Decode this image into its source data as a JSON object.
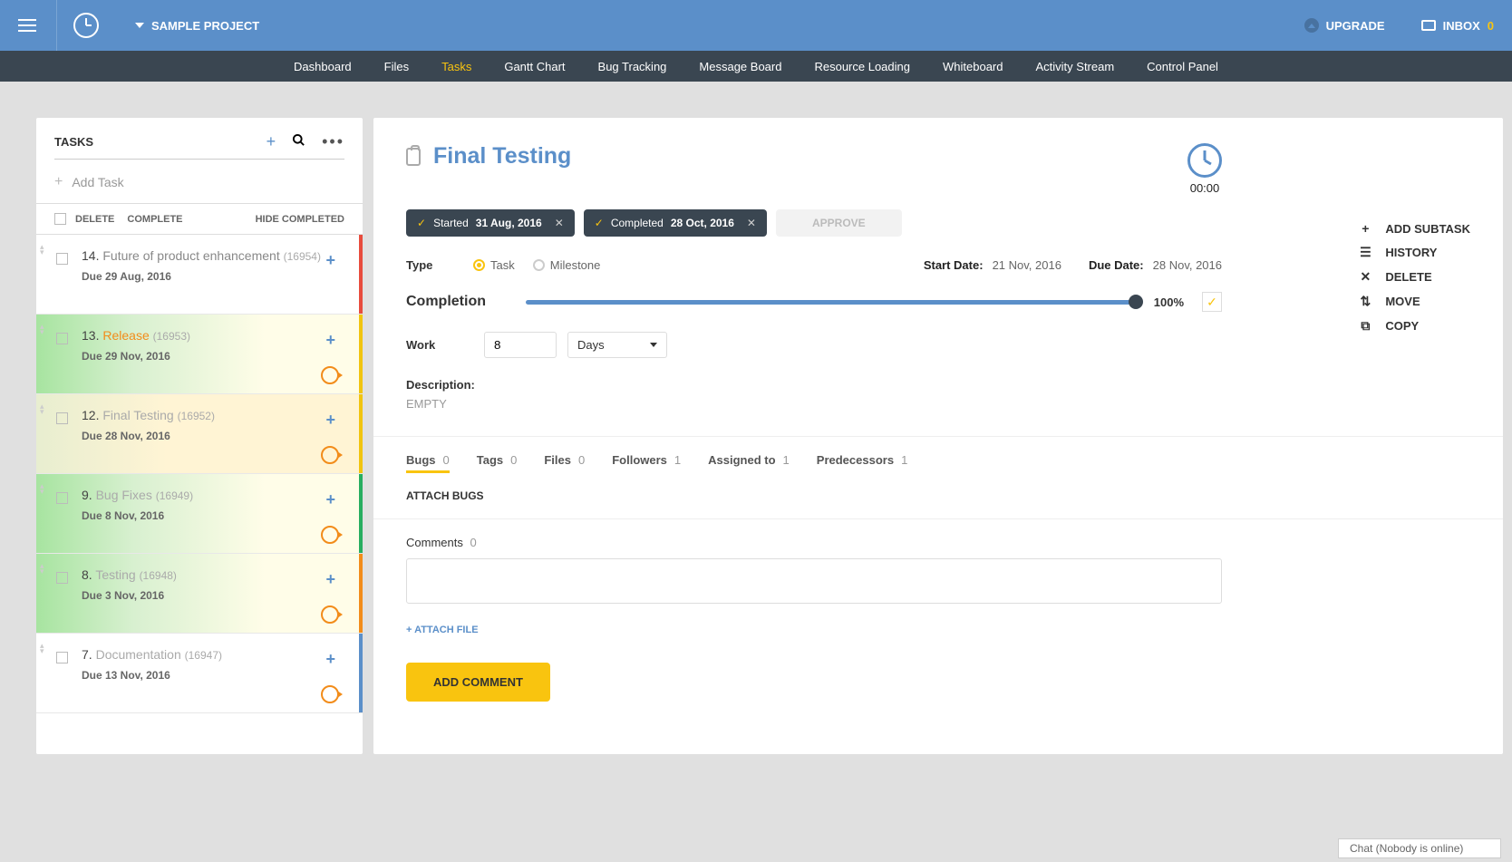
{
  "header": {
    "project_name": "SAMPLE PROJECT",
    "upgrade_label": "UPGRADE",
    "inbox_label": "INBOX",
    "inbox_count": "0"
  },
  "nav": {
    "items": [
      "Dashboard",
      "Files",
      "Tasks",
      "Gantt Chart",
      "Bug Tracking",
      "Message Board",
      "Resource Loading",
      "Whiteboard",
      "Activity Stream",
      "Control Panel"
    ],
    "active": "Tasks"
  },
  "sidebar": {
    "title": "TASKS",
    "add_task": "Add Task",
    "hdr_delete": "DELETE",
    "hdr_complete": "COMPLETE",
    "hdr_hide": "HIDE COMPLETED",
    "tasks": [
      {
        "num": "14.",
        "name": "Future of product enhancement",
        "id": "(16954)",
        "due": "Due 29 Aug, 2016",
        "bg": "bg-white",
        "bar": "#e84c3d",
        "name_color": "#888",
        "spinner": false
      },
      {
        "num": "13.",
        "name": "Release",
        "id": "(16953)",
        "due": "Due 29 Nov, 2016",
        "bg": "bg-green",
        "bar": "#f1c40f",
        "name_color": "#f28c1a",
        "spinner": true
      },
      {
        "num": "12.",
        "name": "Final Testing",
        "id": "(16952)",
        "due": "Due 28 Nov, 2016",
        "bg": "bg-yellow",
        "bar": "#f1c40f",
        "name_color": "#aaa",
        "spinner": true
      },
      {
        "num": "9.",
        "name": "Bug Fixes",
        "id": "(16949)",
        "due": "Due 8 Nov, 2016",
        "bg": "bg-green",
        "bar": "#27ae60",
        "name_color": "#aaa",
        "spinner": true
      },
      {
        "num": "8.",
        "name": "Testing",
        "id": "(16948)",
        "due": "Due 3 Nov, 2016",
        "bg": "bg-green",
        "bar": "#f28c1a",
        "name_color": "#aaa",
        "spinner": true
      },
      {
        "num": "7.",
        "name": "Documentation",
        "id": "(16947)",
        "due": "Due 13 Nov, 2016",
        "bg": "bg-white",
        "bar": "#5b8fc9",
        "name_color": "#aaa",
        "spinner": true
      }
    ]
  },
  "detail": {
    "title": "Final Testing",
    "timer": "00:00",
    "status_started_label": "Started",
    "status_started_date": "31 Aug, 2016",
    "status_completed_label": "Completed",
    "status_completed_date": "28 Oct, 2016",
    "approve_label": "APPROVE",
    "actions": {
      "add_subtask": "ADD SUBTASK",
      "history": "HISTORY",
      "delete": "DELETE",
      "move": "MOVE",
      "copy": "COPY"
    },
    "type_label": "Type",
    "type_task": "Task",
    "type_milestone": "Milestone",
    "start_date_label": "Start Date:",
    "start_date": "21 Nov, 2016",
    "due_date_label": "Due Date:",
    "due_date": "28 Nov, 2016",
    "completion_label": "Completion",
    "completion_pct": "100%",
    "work_label": "Work",
    "work_value": "8",
    "work_unit": "Days",
    "desc_label": "Description:",
    "desc_value": "EMPTY",
    "tabs": [
      {
        "label": "Bugs",
        "count": "0",
        "active": true
      },
      {
        "label": "Tags",
        "count": "0",
        "active": false
      },
      {
        "label": "Files",
        "count": "0",
        "active": false
      },
      {
        "label": "Followers",
        "count": "1",
        "active": false
      },
      {
        "label": "Assigned to",
        "count": "1",
        "active": false
      },
      {
        "label": "Predecessors",
        "count": "1",
        "active": false
      }
    ],
    "attach_bugs": "ATTACH BUGS",
    "comments_label": "Comments",
    "comments_count": "0",
    "attach_file": "+ ATTACH FILE",
    "add_comment": "ADD COMMENT"
  },
  "chat": "Chat (Nobody is online)"
}
